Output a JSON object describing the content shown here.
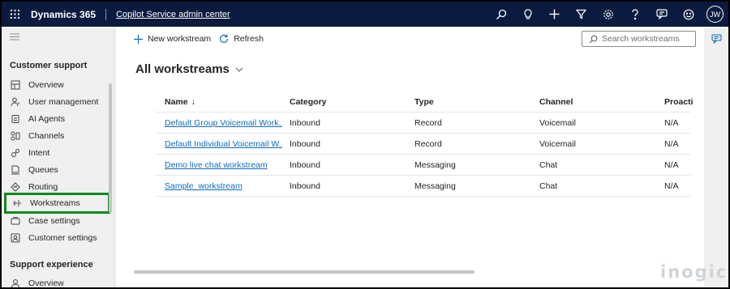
{
  "topbar": {
    "brand": "Dynamics 365",
    "app_name": "Copilot Service admin center",
    "icons": [
      "search-icon",
      "lightbulb-icon",
      "plus-icon",
      "filter-icon",
      "gear-icon",
      "help-icon",
      "chat-icon",
      "smiley-icon"
    ],
    "avatar_initials": "JW",
    "background": "#0b1b3f"
  },
  "sidebar": {
    "section1": "Customer support",
    "items1": [
      {
        "label": "Overview",
        "icon": "overview-icon"
      },
      {
        "label": "User management",
        "icon": "user-management-icon"
      },
      {
        "label": "AI Agents",
        "icon": "ai-agents-icon"
      },
      {
        "label": "Channels",
        "icon": "channels-icon"
      },
      {
        "label": "Intent",
        "icon": "intent-icon"
      },
      {
        "label": "Queues",
        "icon": "queues-icon"
      },
      {
        "label": "Routing",
        "icon": "routing-icon"
      },
      {
        "label": "Workstreams",
        "icon": "workstreams-icon"
      },
      {
        "label": "Case settings",
        "icon": "case-settings-icon"
      },
      {
        "label": "Customer settings",
        "icon": "customer-settings-icon"
      }
    ],
    "section2": "Support experience",
    "items2": [
      {
        "label": "Overview",
        "icon": "overview-icon"
      }
    ],
    "highlight_color": "#0e8a1f"
  },
  "commandbar": {
    "new_label": "New workstream",
    "refresh_label": "Refresh",
    "search_placeholder": "Search workstreams"
  },
  "view": {
    "title": "All workstreams"
  },
  "grid": {
    "columns": [
      "Name",
      "Category",
      "Type",
      "Channel",
      "Proacti"
    ],
    "sort_indicator": "↓",
    "rows": [
      {
        "name": "Default Group Voicemail Work...",
        "category": "Inbound",
        "type": "Record",
        "channel": "Voicemail",
        "proactive": "N/A"
      },
      {
        "name": "Default Individual Voicemail W...",
        "category": "Inbound",
        "type": "Record",
        "channel": "Voicemail",
        "proactive": "N/A"
      },
      {
        "name": "Demo live chat workstream",
        "category": "Inbound",
        "type": "Messaging",
        "channel": "Chat",
        "proactive": "N/A"
      },
      {
        "name": "Sample_workstream",
        "category": "Inbound",
        "type": "Messaging",
        "channel": "Chat",
        "proactive": "N/A"
      }
    ],
    "link_color": "#0f6cbd"
  },
  "watermark": "inogic"
}
